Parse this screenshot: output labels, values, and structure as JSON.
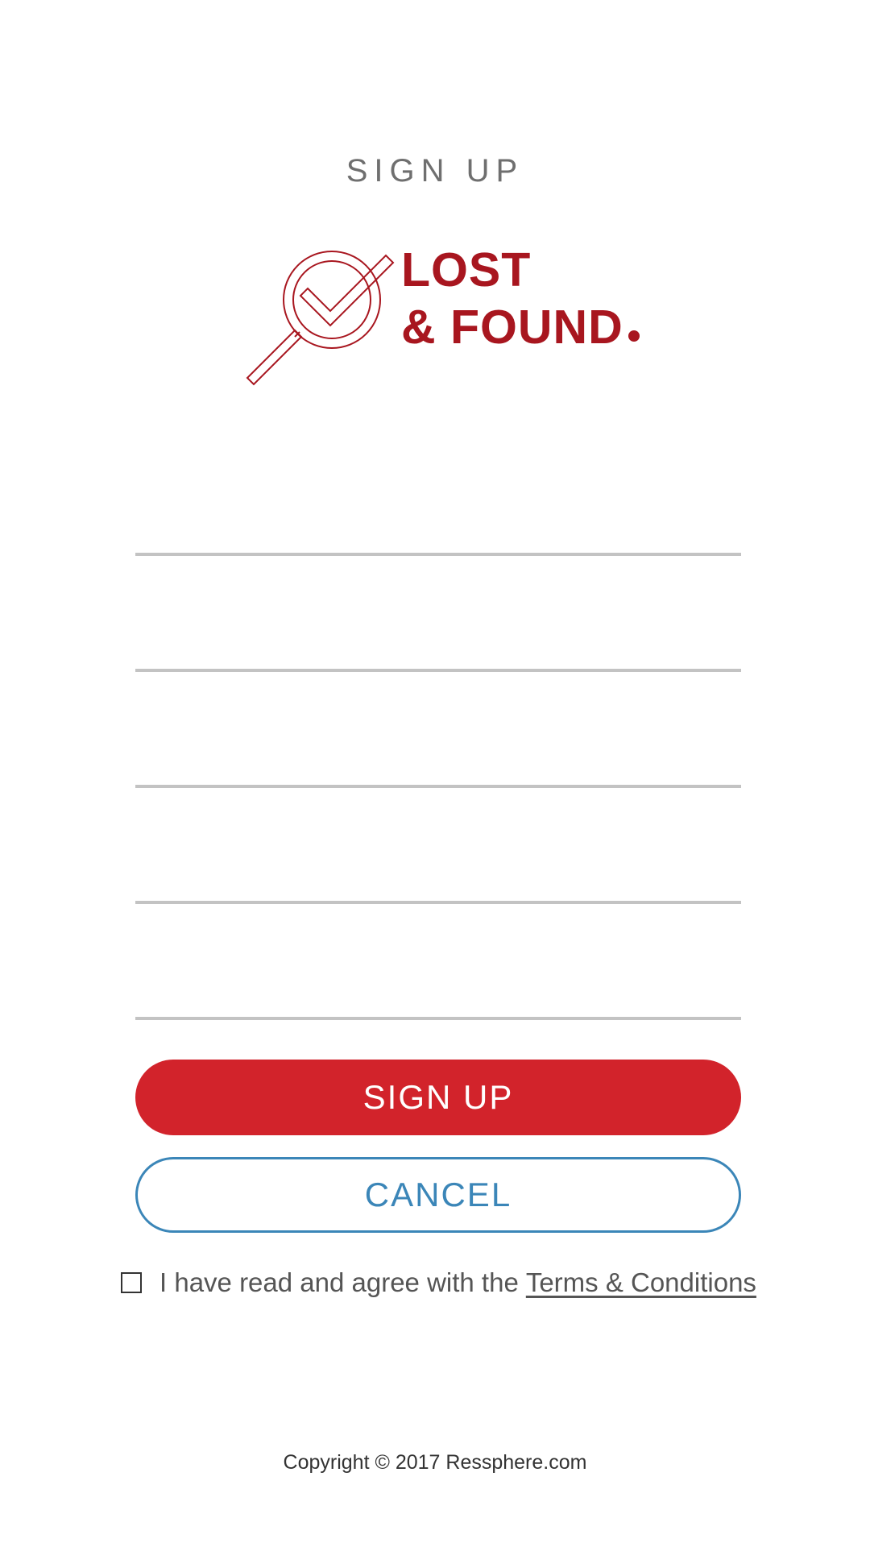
{
  "page": {
    "title": "SIGN UP"
  },
  "logo": {
    "line1": "LOST",
    "line2": "& FOUND",
    "brand_color": "#a8161f",
    "icon": "magnifier-check-icon"
  },
  "form": {
    "fields": [
      {
        "value": "",
        "placeholder": ""
      },
      {
        "value": "",
        "placeholder": ""
      },
      {
        "value": "",
        "placeholder": ""
      },
      {
        "value": "",
        "placeholder": ""
      },
      {
        "value": "",
        "placeholder": ""
      }
    ],
    "underline_color": "#c3c3c3"
  },
  "buttons": {
    "signup_label": "SIGN UP",
    "signup_color": "#d2232b",
    "cancel_label": "CANCEL",
    "cancel_color": "#3b86b8"
  },
  "agreement": {
    "checked": false,
    "text": "I have read and agree with the",
    "link": "Terms & Conditions"
  },
  "footer": {
    "copyright": "Copyright © 2017 Ressphere.com"
  }
}
